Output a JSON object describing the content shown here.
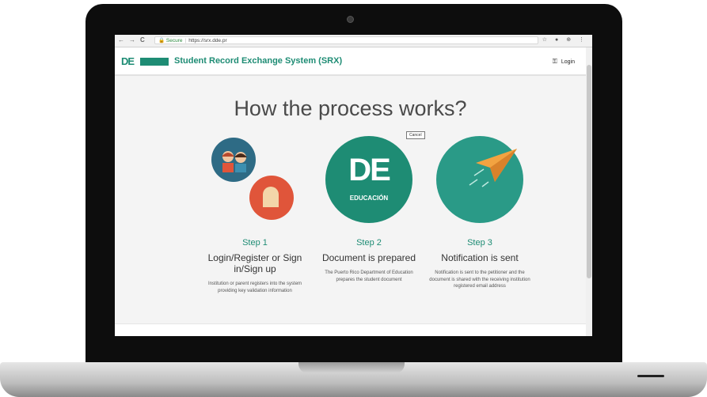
{
  "browser": {
    "back_glyph": "←",
    "forward_glyph": "→",
    "reload_glyph": "C",
    "secure_label": "Secure",
    "url": "https://srx.dde.pr",
    "right_icons": "☆ ● ⊕ ⋮"
  },
  "header": {
    "logo_text": "DE",
    "title": "Student Record Exchange System (SRX)",
    "key_glyph": "⚿",
    "login_label": "Login"
  },
  "main": {
    "heading": "How the process works?",
    "cancel_tooltip": "Cancel"
  },
  "steps": [
    {
      "number": "Step 1",
      "title": "Login/Register or Sign in/Sign up",
      "description": "Institution or parent registers into the system providing key validation information"
    },
    {
      "number": "Step 2",
      "title": "Document is prepared",
      "description": "The Puerto Rico Department of Education prepares the student document"
    },
    {
      "number": "Step 3",
      "title": "Notification is sent",
      "description": "Notification is sent to the petitioner and the document is shared with the receiving institution registered email address"
    }
  ],
  "badge": {
    "de_text": "DE",
    "caption": "EDUCACIÓN"
  },
  "colors": {
    "brand_green": "#1e8c74",
    "teal": "#2a9a87",
    "orange": "#e0553a",
    "blue": "#2e6b85"
  }
}
